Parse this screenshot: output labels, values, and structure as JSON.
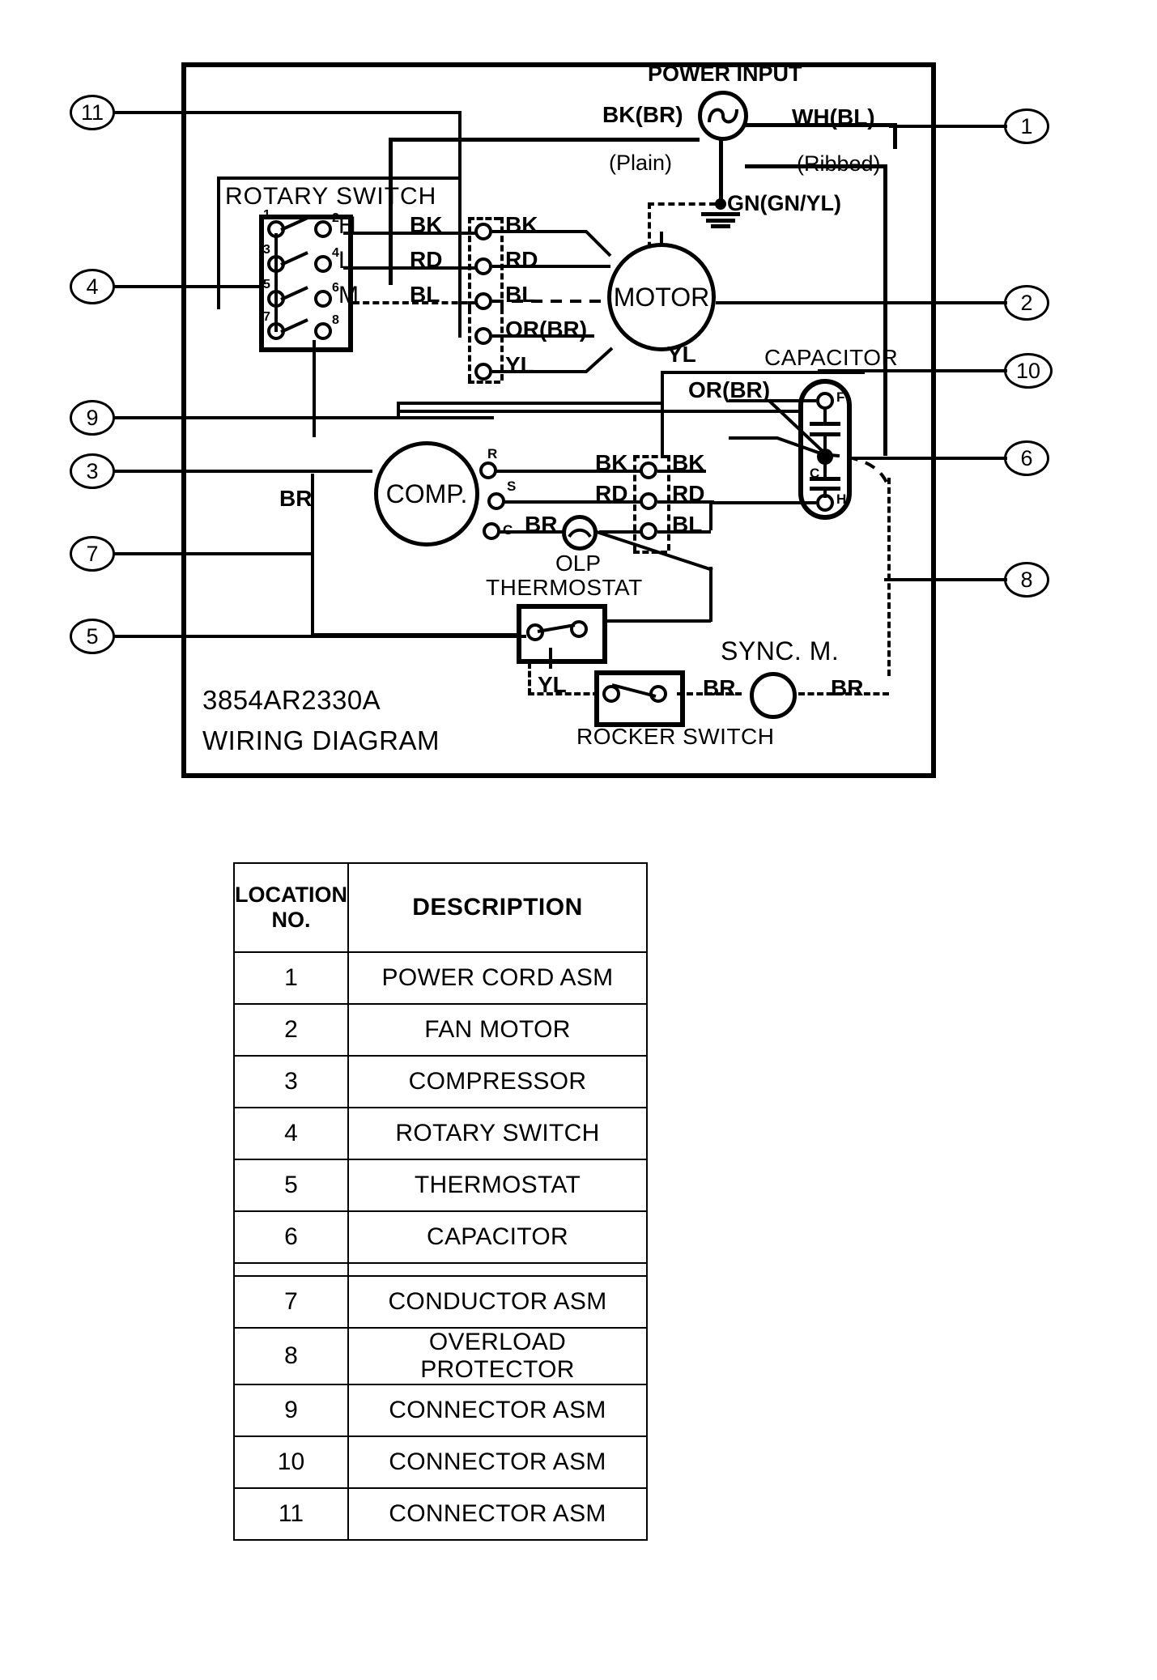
{
  "diagram": {
    "part_number": "3854AR2330A",
    "title": "WIRING DIAGRAM",
    "labels": {
      "power_input": "POWER INPUT",
      "rotary_switch": "ROTARY SWITCH",
      "motor": "MOTOR",
      "comp": "COMP.",
      "capacitor": "CAPACITOR",
      "thermostat": "THERMOSTAT",
      "rocker_switch": "ROCKER SWITCH",
      "sync_m": "SYNC. M.",
      "olp": "OLP"
    },
    "cord_wires": {
      "line_color": "BK(BR)",
      "line_note": "(Plain)",
      "neutral_color": "WH(BL)",
      "neutral_note": "(Ribbed)",
      "ground_color": "GN(GN/YL)"
    },
    "rotary_switch": {
      "terminals": [
        "1",
        "2",
        "3",
        "4",
        "5",
        "6",
        "7",
        "8"
      ],
      "speeds": [
        "H",
        "L",
        "M"
      ]
    },
    "motor_wires_left": [
      "BK",
      "RD",
      "BL"
    ],
    "motor_wires_right": [
      "BK",
      "RD",
      "BL",
      "OR(BR)",
      "YL"
    ],
    "motor_feed": [
      "YL",
      "OR(BR)"
    ],
    "comp_terminals": [
      "R",
      "S",
      "C"
    ],
    "comp_wires_left": [
      "BK",
      "RD",
      "BR"
    ],
    "comp_wires_right": [
      "BK",
      "RD",
      "BL"
    ],
    "capacitor_terminals": [
      "F",
      "C",
      "H"
    ],
    "conductor_label": "BR",
    "rocker_wires": {
      "in": "YL",
      "out": "BR",
      "sync_out": "BR"
    },
    "callouts_left": [
      "11",
      "4",
      "9",
      "3",
      "7",
      "5"
    ],
    "callouts_right": [
      "1",
      "2",
      "10",
      "6",
      "8"
    ]
  },
  "parts_table": {
    "headers": {
      "location": "LOCATION\nNO.",
      "location_line1": "LOCATION",
      "location_line2": "NO.",
      "description": "DESCRIPTION"
    },
    "rows": [
      {
        "no": "1",
        "description": "POWER CORD ASM"
      },
      {
        "no": "2",
        "description": "FAN MOTOR"
      },
      {
        "no": "3",
        "description": "COMPRESSOR"
      },
      {
        "no": "4",
        "description": "ROTARY SWITCH"
      },
      {
        "no": "5",
        "description": "THERMOSTAT"
      },
      {
        "no": "6",
        "description": "CAPACITOR"
      },
      {
        "no": "7",
        "description": "CONDUCTOR ASM"
      },
      {
        "no": "8",
        "description": "OVERLOAD PROTECTOR"
      },
      {
        "no": "9",
        "description": "CONNECTOR ASM"
      },
      {
        "no": "10",
        "description": "CONNECTOR ASM"
      },
      {
        "no": "11",
        "description": "CONNECTOR ASM"
      }
    ]
  },
  "colors": {
    "ink": "#000000",
    "paper": "#ffffff"
  }
}
